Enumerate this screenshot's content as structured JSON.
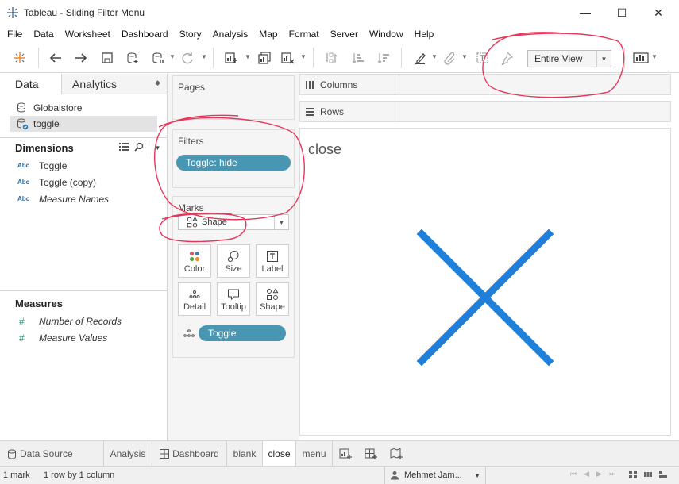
{
  "window": {
    "title": "Tableau - Sliding Filter Menu",
    "minimize": "—",
    "maximize": "☐",
    "close": "✕"
  },
  "menu": [
    "File",
    "Data",
    "Worksheet",
    "Dashboard",
    "Story",
    "Analysis",
    "Map",
    "Format",
    "Server",
    "Window",
    "Help"
  ],
  "toolbar": {
    "fit_value": "Entire View"
  },
  "data_pane": {
    "tab_data": "Data",
    "tab_analytics": "Analytics",
    "datasources": [
      "Globalstore",
      "toggle"
    ],
    "dimensions_header": "Dimensions",
    "dimensions": [
      {
        "type": "Abc",
        "name": "Toggle"
      },
      {
        "type": "Abc",
        "name": "Toggle (copy)"
      },
      {
        "type": "Abc",
        "name": "Measure Names"
      }
    ],
    "measures_header": "Measures",
    "measures": [
      {
        "type": "#",
        "name": "Number of Records"
      },
      {
        "type": "#",
        "name": "Measure Values"
      }
    ]
  },
  "shelves": {
    "pages": "Pages",
    "filters": "Filters",
    "filter_pill": "Toggle: hide",
    "marks": "Marks",
    "mark_type": "Shape",
    "mark_buttons": [
      "Color",
      "Size",
      "Label",
      "Detail",
      "Tooltip",
      "Shape"
    ],
    "marks_pill": "Toggle",
    "columns": "Columns",
    "rows": "Rows"
  },
  "view": {
    "title": "close",
    "mark_color": "#1f7fd9"
  },
  "sheet_tabs": {
    "data_source": "Data Source",
    "tabs": [
      "Analysis",
      "Dashboard",
      "blank",
      "close",
      "menu"
    ],
    "active": "close"
  },
  "status": {
    "marks": "1 mark",
    "rows_cols": "1 row by 1 column",
    "user": "Mehmet Jam..."
  },
  "colors": {
    "pill": "#4996b2",
    "annotation": "#e8365a",
    "accent": "#1f7fd9"
  }
}
